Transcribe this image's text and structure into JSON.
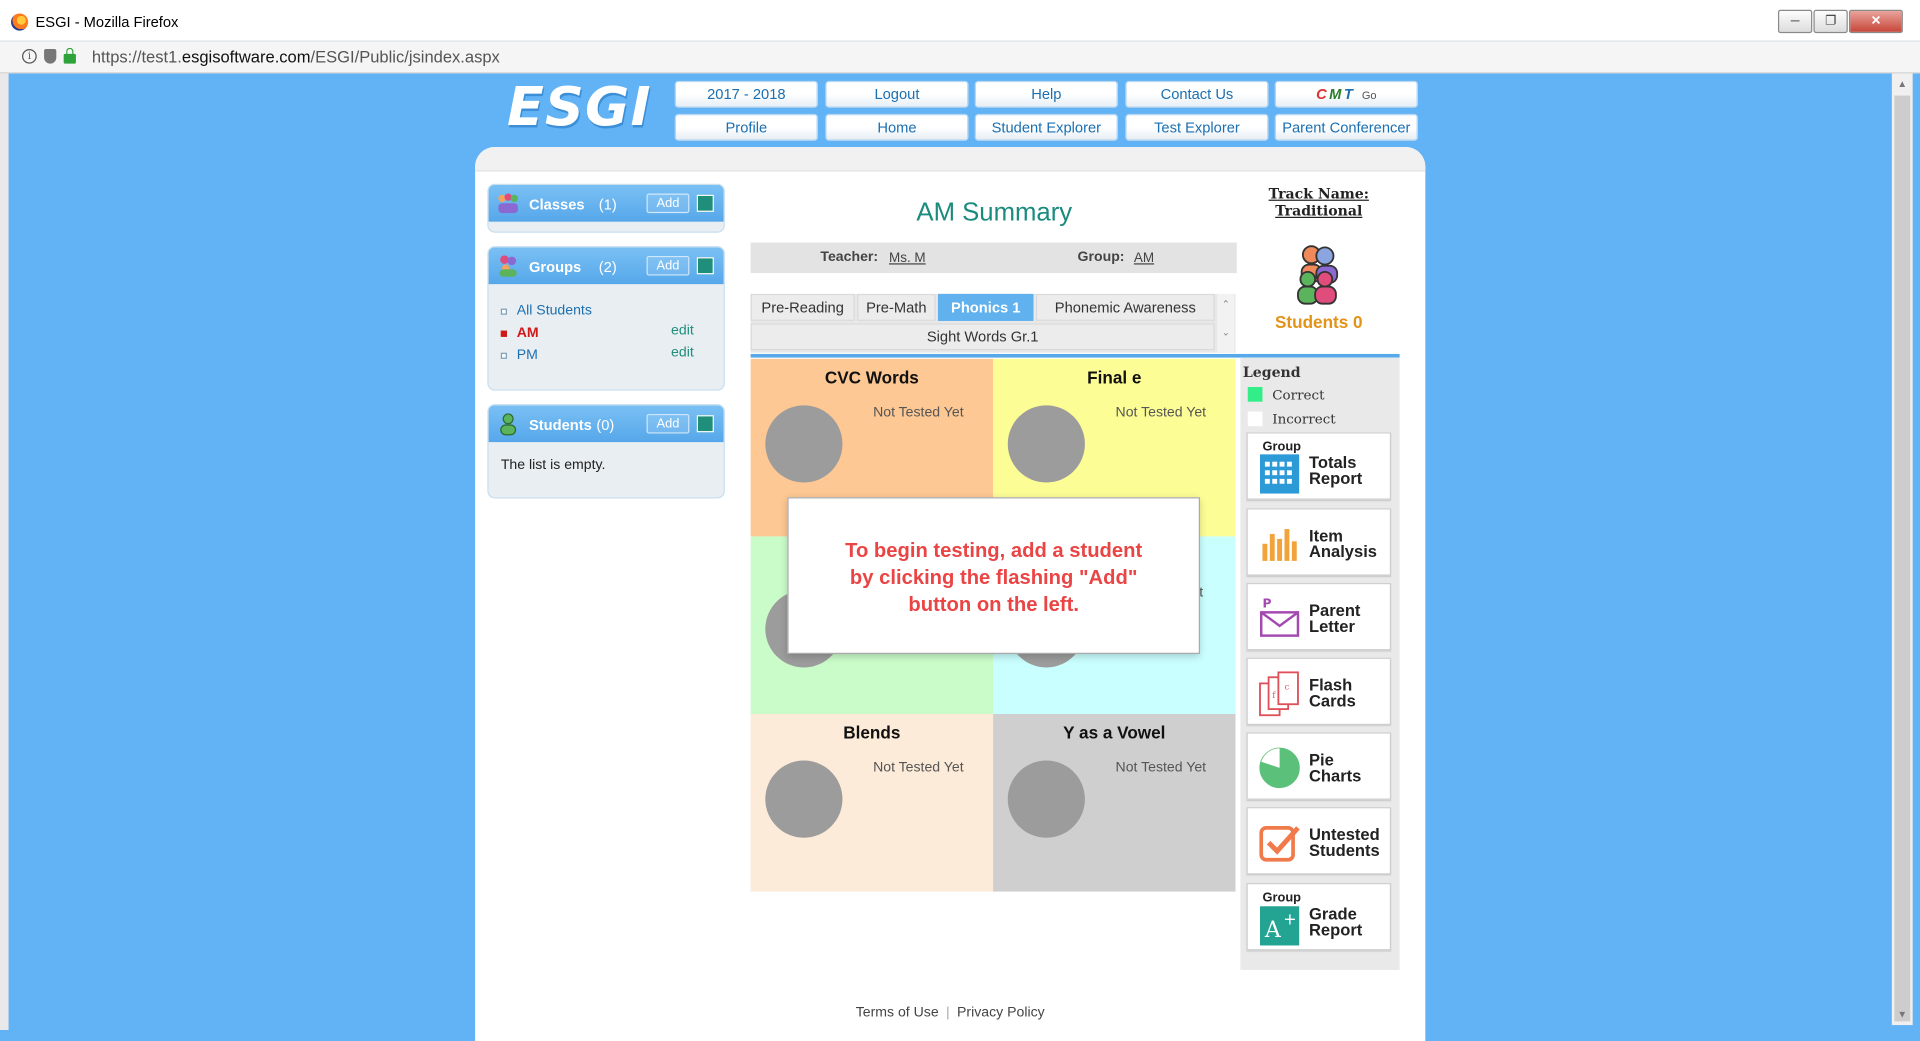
{
  "window": {
    "title": "ESGI - Mozilla Firefox",
    "url_prefix": "https://test1.",
    "url_domain": "esgisoftware.com",
    "url_path": "/ESGI/Public/jsindex.aspx"
  },
  "header": {
    "logo": "ESGI",
    "nav_row1": [
      "2017 - 2018",
      "Logout",
      "Help",
      "Contact Us"
    ],
    "nav_row2": [
      "Profile",
      "Home",
      "Student Explorer",
      "Test Explorer",
      "Parent Conferencer"
    ],
    "cmt": {
      "c": "C",
      "m": "M",
      "t": "T",
      "go": "Go"
    }
  },
  "sidebar": {
    "classes": {
      "title": "Classes",
      "count": "(1)",
      "add": "Add"
    },
    "groups": {
      "title": "Groups",
      "count": "(2)",
      "add": "Add",
      "items": [
        {
          "name": "All Students",
          "edit": ""
        },
        {
          "name": "AM",
          "edit": "edit"
        },
        {
          "name": "PM",
          "edit": "edit"
        }
      ]
    },
    "students": {
      "title": "Students",
      "count": "(0)",
      "add": "Add",
      "empty": "The list is empty."
    }
  },
  "main": {
    "title": "AM Summary",
    "teacher_label": "Teacher:",
    "teacher_value": "Ms. M",
    "group_label": "Group:",
    "group_value": "AM",
    "tabs": [
      "Pre-Reading",
      "Pre-Math",
      "Phonics 1",
      "Phonemic Awareness",
      "Sight Words Gr.1"
    ],
    "tiles": [
      {
        "name": "CVC Words",
        "status": "Not Tested Yet",
        "color": "#fdc893"
      },
      {
        "name": "Final e",
        "status": "Not Tested Yet",
        "color": "#fdfd96"
      },
      {
        "name": "",
        "status": "",
        "color": "#cafcca"
      },
      {
        "name": "",
        "status": "et",
        "color": "#caffff"
      },
      {
        "name": "Blends",
        "status": "Not Tested Yet",
        "color": "#fdebd9"
      },
      {
        "name": "Y as a Vowel",
        "status": "Not Tested Yet",
        "color": "#cfcfcf"
      }
    ],
    "modal": "To begin testing, add a student\nby clicking the flashing \"Add\"\nbutton on the left."
  },
  "right": {
    "track_label": "Track Name:",
    "track_value": "Traditional",
    "students": "Students 0",
    "legend_title": "Legend",
    "legend_correct": "Correct",
    "legend_incorrect": "Incorrect",
    "colors": {
      "correct": "#33ee88",
      "incorrect": "#ffffff"
    },
    "reports": [
      {
        "small": "Group",
        "label": "Totals\nReport",
        "icon": "totals-icon"
      },
      {
        "small": "",
        "label": "Item\nAnalysis",
        "icon": "bar-chart-icon"
      },
      {
        "small": "",
        "label": "Parent\nLetter",
        "icon": "letter-icon"
      },
      {
        "small": "",
        "label": "Flash\nCards",
        "icon": "flash-cards-icon"
      },
      {
        "small": "",
        "label": "Pie\nCharts",
        "icon": "pie-chart-icon"
      },
      {
        "small": "",
        "label": "Untested\nStudents",
        "icon": "checkbox-icon"
      },
      {
        "small": "Group",
        "label": "Grade\nReport",
        "icon": "grade-icon"
      }
    ]
  },
  "footer": {
    "terms": "Terms of Use",
    "sep": "|",
    "privacy": "Privacy Policy"
  }
}
